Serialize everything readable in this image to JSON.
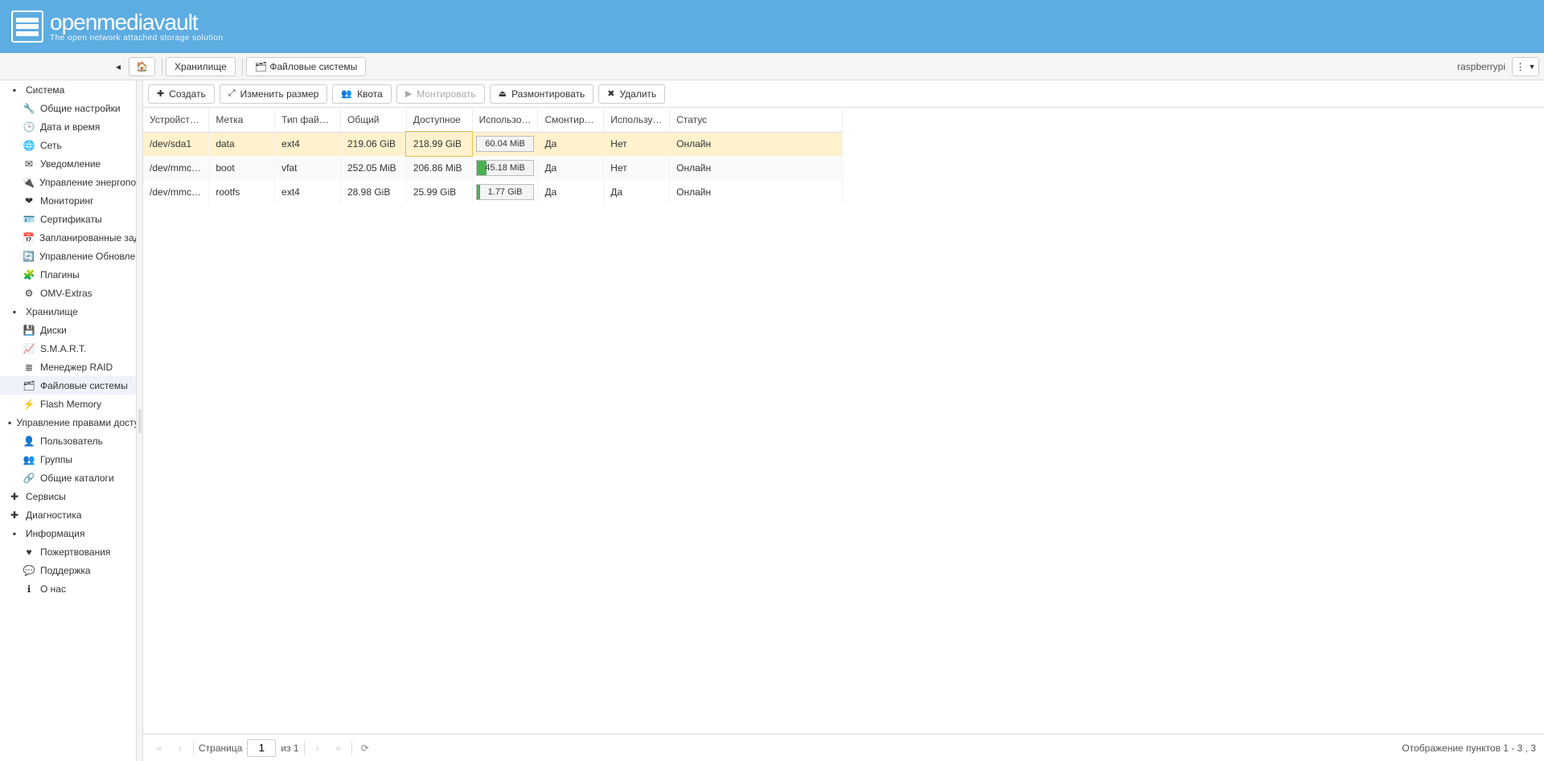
{
  "brand": {
    "title": "openmediavault",
    "subtitle": "The open network attached storage solution"
  },
  "breadcrumbs": {
    "storage": "Хранилище",
    "filesystems": "Файловые системы"
  },
  "host": "raspberrypi",
  "sidebar": {
    "system": "Система",
    "system_items": [
      "Общие настройки",
      "Дата и время",
      "Сеть",
      "Уведомление",
      "Управление энергопотр",
      "Мониторинг",
      "Сертификаты",
      "Запланированные задан",
      "Управление Обновлени",
      "Плагины",
      "OMV-Extras"
    ],
    "storage": "Хранилище",
    "storage_items": [
      "Диски",
      "S.M.A.R.T.",
      "Менеджер RAID",
      "Файловые системы",
      "Flash Memory"
    ],
    "access": "Управление правами досту",
    "access_items": [
      "Пользователь",
      "Группы",
      "Общие каталоги"
    ],
    "services": "Сервисы",
    "diag": "Диагностика",
    "info": "Информация",
    "info_items": [
      "Пожертвования",
      "Поддержка",
      "О нас"
    ]
  },
  "actions": {
    "create": "Создать",
    "resize": "Изменить размер",
    "quota": "Квота",
    "mount": "Монтировать",
    "unmount": "Размонтировать",
    "delete": "Удалить"
  },
  "columns": {
    "device": "Устройств…",
    "label": "Метка",
    "fstype": "Тип файло…",
    "total": "Общий",
    "avail": "Доступное",
    "used": "Использов…",
    "mounted": "Смонтиро…",
    "referenced": "Используе…",
    "status": "Статус"
  },
  "rows": [
    {
      "device": "/dev/sda1",
      "label": "data",
      "fstype": "ext4",
      "total": "219.06 GiB",
      "avail": "218.99 GiB",
      "used": "60.04 MiB",
      "used_pct": 0.1,
      "mounted": "Да",
      "referenced": "Нет",
      "status": "Онлайн"
    },
    {
      "device": "/dev/mmc…",
      "label": "boot",
      "fstype": "vfat",
      "total": "252.05 MiB",
      "avail": "206.86 MiB",
      "used": "45.18 MiB",
      "used_pct": 18,
      "mounted": "Да",
      "referenced": "Нет",
      "status": "Онлайн"
    },
    {
      "device": "/dev/mmc…",
      "label": "rootfs",
      "fstype": "ext4",
      "total": "28.98 GiB",
      "avail": "25.99 GiB",
      "used": "1.77 GiB",
      "used_pct": 6,
      "mounted": "Да",
      "referenced": "Да",
      "status": "Онлайн"
    }
  ],
  "pager": {
    "page_label": "Страница",
    "page": "1",
    "of": "из 1",
    "display": "Отображение пунктов 1 - 3 , 3"
  },
  "icons": {
    "system": [
      "🔧",
      "🕒",
      "🌐",
      "✉",
      "🔌",
      "❤",
      "🪪",
      "📅",
      "🔄",
      "🧩",
      "⚙"
    ],
    "storage": [
      "💾",
      "📈",
      "≣",
      "🗂",
      "⚡"
    ],
    "access": [
      "👤",
      "👥",
      "🔗"
    ],
    "info": [
      "♥",
      "💬",
      "ℹ"
    ]
  }
}
